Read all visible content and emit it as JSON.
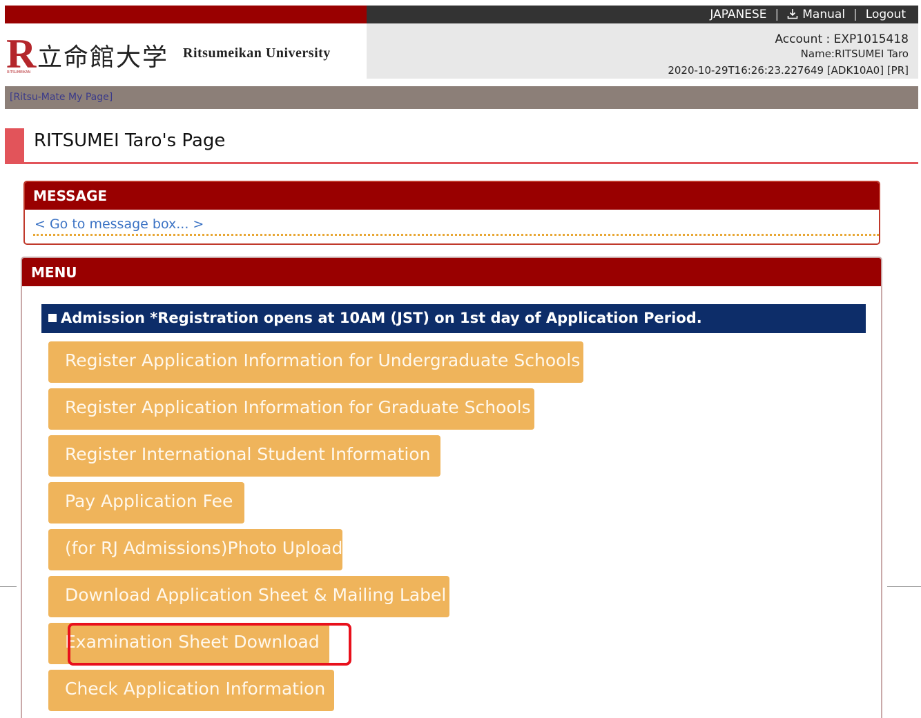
{
  "header": {
    "top_links": {
      "language": "JAPANESE",
      "manual": "Manual",
      "logout": "Logout"
    },
    "logo": {
      "letter": "R",
      "letter_sub": "RITSUMEIKAN",
      "japanese_name": "立命館大学",
      "english_name": "Ritsumeikan University"
    },
    "account": {
      "account_line": "Account : EXP1015418",
      "name_line": "Name:RITSUMEI Taro",
      "timestamp_line": "2020-10-29T16:26:23.227649 [ADK10A0] [PR]"
    },
    "breadcrumb": "[Ritsu-Mate My Page]"
  },
  "page": {
    "title": "RITSUMEI Taro's Page"
  },
  "message_panel": {
    "heading": "MESSAGE",
    "link": "< Go to message box... >"
  },
  "menu_panel": {
    "heading": "MENU",
    "section_title": "Admission *Registration opens at 10AM (JST) on 1st day of Application Period.",
    "buttons": [
      "Register Application Information for Undergraduate Schools",
      "Register Application Information for Graduate Schools",
      "Register International Student Information",
      "Pay Application Fee",
      "(for RJ Admissions)Photo Upload",
      "Download Application Sheet & Mailing Label",
      "Examination Sheet Download",
      "Check Application Information"
    ],
    "highlighted_button": "Examination Sheet Download"
  },
  "colors": {
    "brand_red": "#990000",
    "accent_red": "#e2545a",
    "section_navy": "#0d2d69",
    "button_orange": "#efb45b",
    "highlight_red": "#e8101c"
  },
  "icons": {
    "manual": "download-icon"
  }
}
